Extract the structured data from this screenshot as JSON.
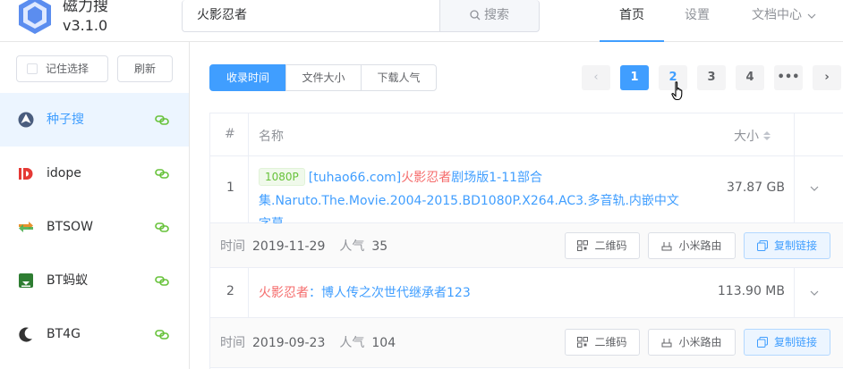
{
  "app": {
    "name": "磁力搜",
    "version": "v3.1.0"
  },
  "search": {
    "value": "火影忍者",
    "button_label": "搜索"
  },
  "nav": {
    "home": "首页",
    "settings": "设置",
    "docs": "文档中心"
  },
  "sidebar": {
    "remember_label": "记住选择",
    "refresh_label": "刷新",
    "sites": [
      {
        "label": "种子搜",
        "icon": "torrent-search-icon",
        "active": true
      },
      {
        "label": "idope",
        "icon": "idope-icon",
        "active": false
      },
      {
        "label": "BTSOW",
        "icon": "btsow-icon",
        "active": false
      },
      {
        "label": "BT蚂蚁",
        "icon": "bt-ant-icon",
        "active": false
      },
      {
        "label": "BT4G",
        "icon": "bt4g-icon",
        "active": false
      }
    ]
  },
  "sort": {
    "by_time": "收录时间",
    "by_size": "文件大小",
    "by_popularity": "下载人气",
    "active": "by_time"
  },
  "pagination": {
    "pages": [
      "1",
      "2",
      "3",
      "4",
      "•••"
    ],
    "current": "1",
    "prev": "‹",
    "next": "›"
  },
  "table": {
    "col_index": "#",
    "col_name": "名称",
    "col_size": "大小",
    "rows": [
      {
        "index": "1",
        "tag": "1080P",
        "title_prefix": "[tuhao66.com]",
        "title_highlight": "火影忍者",
        "title_rest": "剧场版1-11部合集.Naruto.The.Movie.2004-2015.BD1080P.X264.AC3.多音轨.内嵌中文字幕",
        "size": "37.87 GB",
        "time_label": "时间",
        "time": "2019-11-29",
        "pop_label": "人气",
        "pop": "35"
      },
      {
        "index": "2",
        "tag": "",
        "title_prefix": "",
        "title_highlight": "火影忍者",
        "title_rest": "：博人传之次世代继承者123",
        "size": "113.90 MB",
        "time_label": "时间",
        "time": "2019-09-23",
        "pop_label": "人气",
        "pop": "104"
      }
    ],
    "actions": {
      "qr": "二维码",
      "xiaomi": "小米路由",
      "copy": "复制链接"
    }
  },
  "colors": {
    "primary": "#409eff",
    "highlight": "#f56c6c",
    "tag_green": "#67c23a"
  }
}
